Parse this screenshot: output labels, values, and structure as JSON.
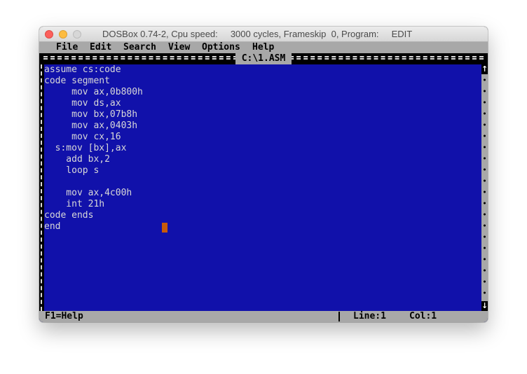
{
  "window": {
    "title": "DOSBox 0.74-2, Cpu speed:     3000 cycles, Frameskip  0, Program:     EDIT"
  },
  "menu": [
    {
      "label": "File"
    },
    {
      "label": "Edit"
    },
    {
      "label": "Search"
    },
    {
      "label": "View"
    },
    {
      "label": "Options"
    },
    {
      "label": "Help"
    }
  ],
  "editor": {
    "filename": "C:\\1.ASM",
    "lines": [
      "assume cs:code",
      "code segment",
      "     mov ax,0b800h",
      "     mov ds,ax",
      "     mov bx,07b8h",
      "     mov ax,0403h",
      "     mov cx,16",
      "  s:mov [bx],ax",
      "    add bx,2",
      "    loop s",
      "",
      "    mov ax,4c00h",
      "    int 21h",
      "code ends",
      "end"
    ]
  },
  "scrollbar": {
    "up_icon": "arrow-up-icon",
    "down_icon": "arrow-down-icon",
    "up_glyph": "↑",
    "down_glyph": "↓"
  },
  "status": {
    "help": "F1=Help",
    "line": "Line:1",
    "col": "Col:1"
  },
  "colors": {
    "dos_blue": "#1111aa",
    "gray": "#a8a8a8",
    "text": "#d8d8d8",
    "cursor": "#c85a0a"
  }
}
